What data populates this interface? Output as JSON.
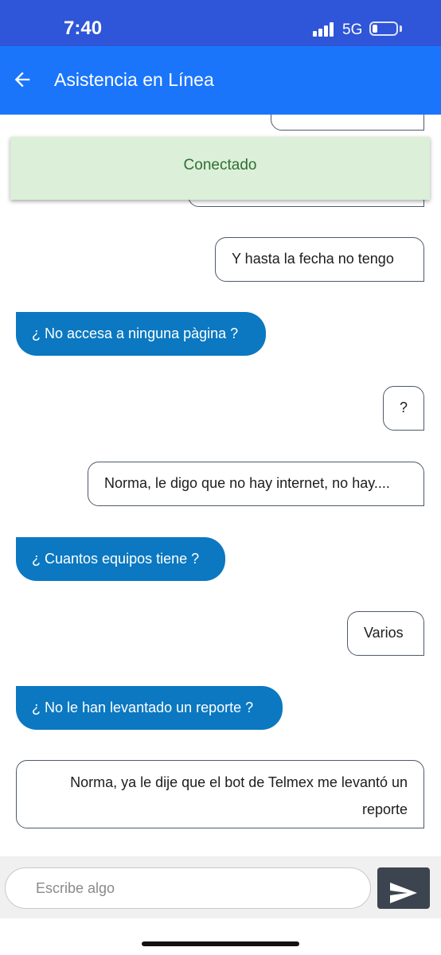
{
  "status_bar": {
    "time": "7:40",
    "network": "5G",
    "icons": [
      "signal-icon",
      "battery-icon"
    ]
  },
  "header": {
    "title": "Asistencia en Línea",
    "back_icon": "arrow-left-icon"
  },
  "banner": {
    "text": "Conectado"
  },
  "messages": [
    {
      "sender": "user",
      "text": "Y hasta la fecha no tengo"
    },
    {
      "sender": "agent",
      "text": "¿ No accesa a ninguna pàgina ?"
    },
    {
      "sender": "user",
      "text": "?"
    },
    {
      "sender": "user",
      "text": "Norma, le digo que no hay internet, no hay...."
    },
    {
      "sender": "agent",
      "text": "¿ Cuantos equipos tiene ?"
    },
    {
      "sender": "user",
      "text": "Varios"
    },
    {
      "sender": "agent",
      "text": "¿ No le han levantado un reporte ?"
    },
    {
      "sender": "user",
      "text": "Norma, ya le dije que el bot de Telmex me levantó un reporte"
    }
  ],
  "composer": {
    "placeholder": "Escribe algo",
    "value": "",
    "send_icon": "send-icon"
  },
  "colors": {
    "status_bar": "#2f55d8",
    "app_bar": "#1a75fb",
    "agent_bubble": "#0b78c1",
    "banner_bg": "#dcefd8",
    "banner_text": "#2f6f34",
    "send_button": "#3c4450"
  }
}
